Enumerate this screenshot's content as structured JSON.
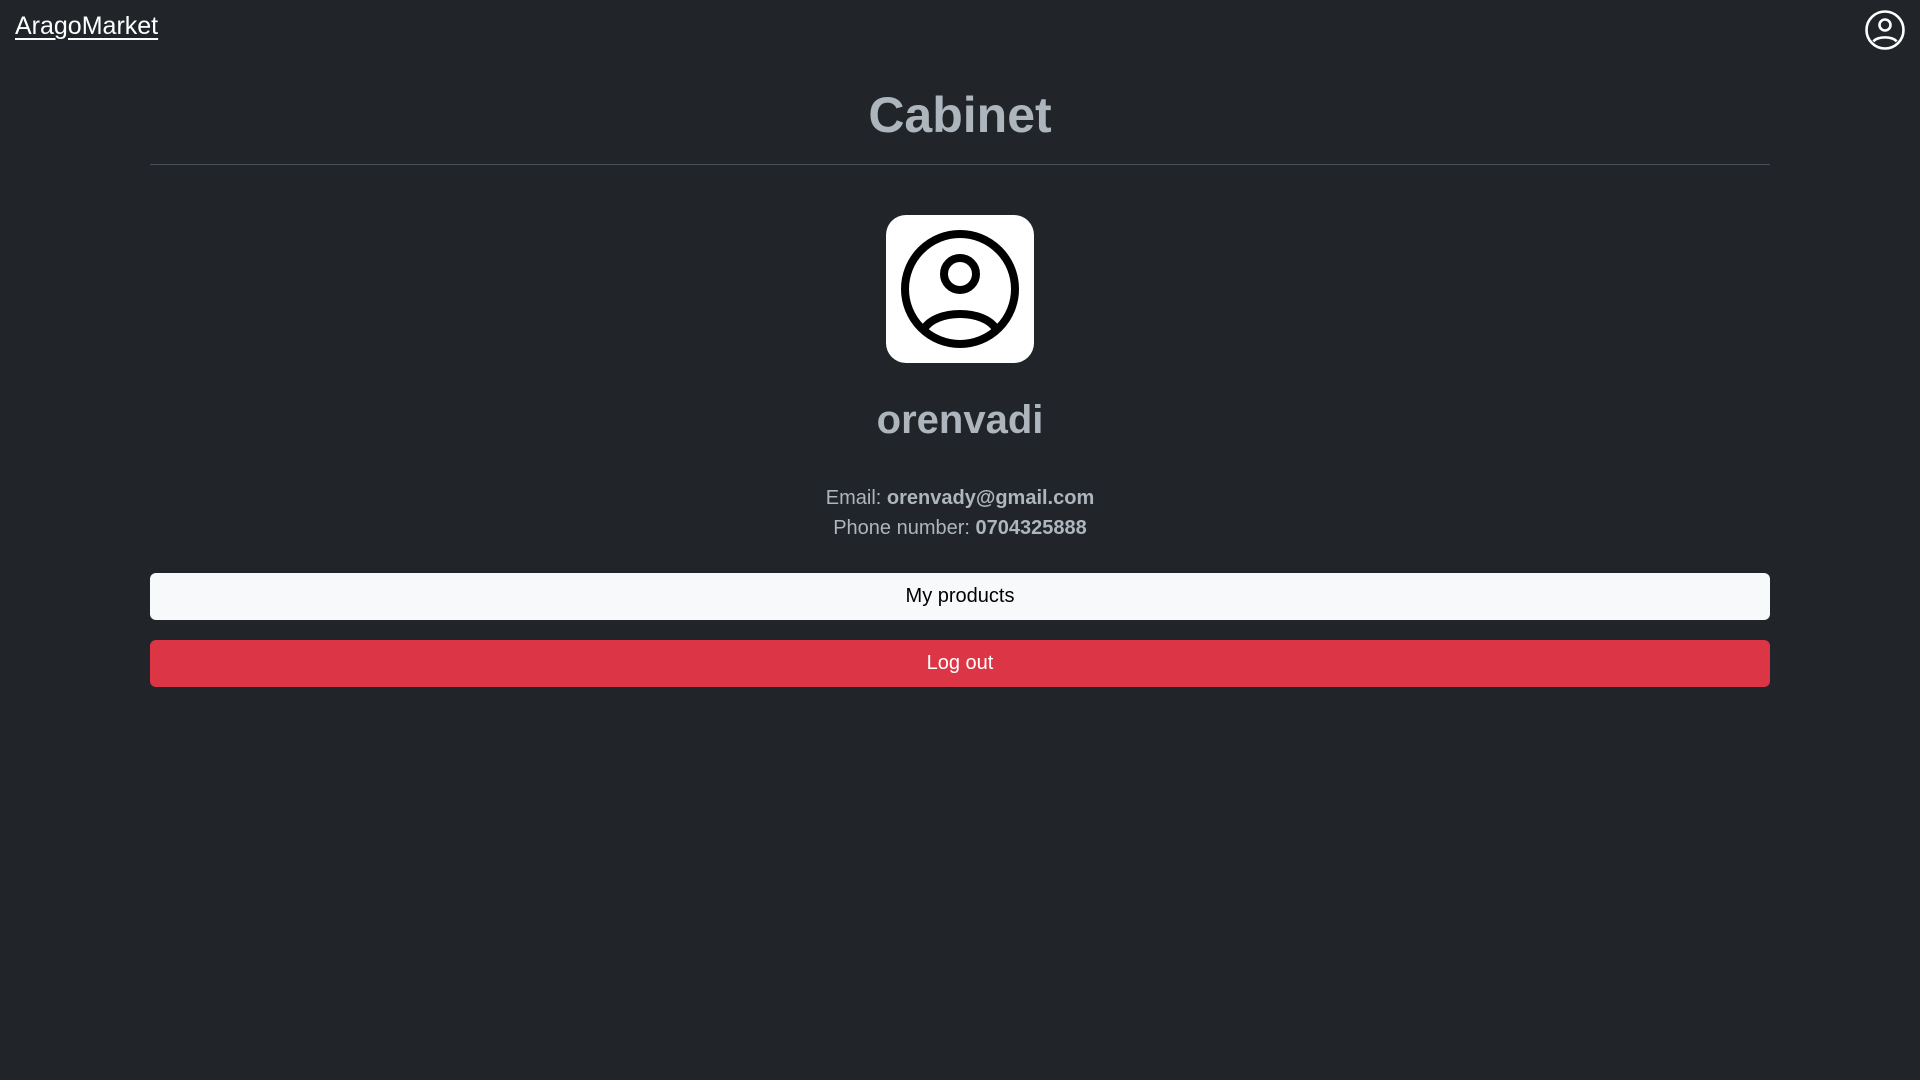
{
  "header": {
    "brand": "AragoMarket",
    "account_icon": "user-circle-icon"
  },
  "main": {
    "title": "Cabinet",
    "avatar_icon": "user-circle-icon",
    "username": "orenvadi",
    "email_label": "Email:",
    "email_value": "orenvady@gmail.com",
    "phone_label": "Phone number:",
    "phone_value": "0704325888",
    "my_products_label": "My products",
    "logout_label": "Log out"
  },
  "colors": {
    "background": "#212529",
    "muted_text": "#adb5bd",
    "light_button": "#f8f9fa",
    "danger_button": "#dc3545"
  }
}
